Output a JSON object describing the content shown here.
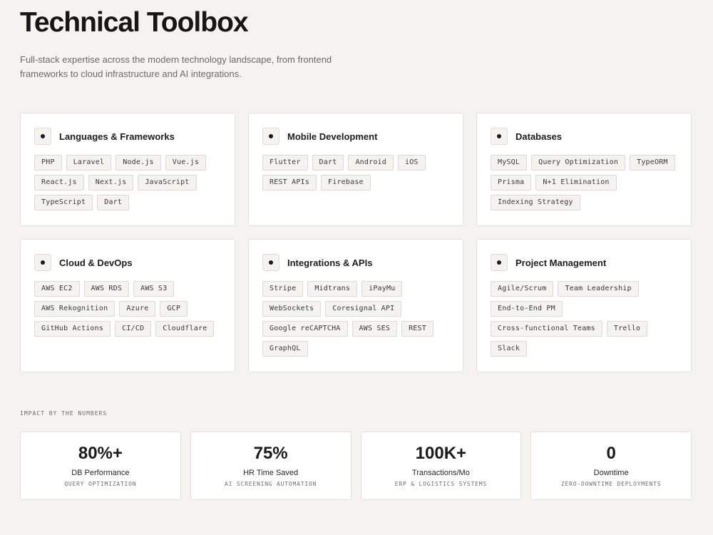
{
  "header": {
    "title": "Technical Toolbox",
    "subtitle": "Full-stack expertise across the modern technology landscape, from frontend frameworks to cloud infrastructure and AI integrations."
  },
  "cards": [
    {
      "title": "Languages & Frameworks",
      "tags": [
        "PHP",
        "Laravel",
        "Node.js",
        "Vue.js",
        "React.js",
        "Next.js",
        "JavaScript",
        "TypeScript",
        "Dart"
      ]
    },
    {
      "title": "Mobile Development",
      "tags": [
        "Flutter",
        "Dart",
        "Android",
        "iOS",
        "REST APIs",
        "Firebase"
      ]
    },
    {
      "title": "Databases",
      "tags": [
        "MySQL",
        "Query Optimization",
        "TypeORM",
        "Prisma",
        "N+1 Elimination",
        "Indexing Strategy"
      ]
    },
    {
      "title": "Cloud & DevOps",
      "tags": [
        "AWS EC2",
        "AWS RDS",
        "AWS S3",
        "AWS Rekognition",
        "Azure",
        "GCP",
        "GitHub Actions",
        "CI/CD",
        "Cloudflare"
      ]
    },
    {
      "title": "Integrations & APIs",
      "tags": [
        "Stripe",
        "Midtrans",
        "iPayMu",
        "WebSockets",
        "Coresignal API",
        "Google reCAPTCHA",
        "AWS SES",
        "REST",
        "GraphQL"
      ]
    },
    {
      "title": "Project Management",
      "tags": [
        "Agile/Scrum",
        "Team Leadership",
        "End-to-End PM",
        "Cross-functional Teams",
        "Trello",
        "Slack"
      ]
    }
  ],
  "impact": {
    "label": "IMPACT BY THE NUMBERS",
    "stats": [
      {
        "value": "80%+",
        "label": "DB Performance",
        "sub": "QUERY OPTIMIZATION"
      },
      {
        "value": "75%",
        "label": "HR Time Saved",
        "sub": "AI SCREENING AUTOMATION"
      },
      {
        "value": "100K+",
        "label": "Transactions/Mo",
        "sub": "ERP & LOGISTICS SYSTEMS"
      },
      {
        "value": "0",
        "label": "Downtime",
        "sub": "ZERO-DOWNTIME DEPLOYMENTS"
      }
    ]
  }
}
